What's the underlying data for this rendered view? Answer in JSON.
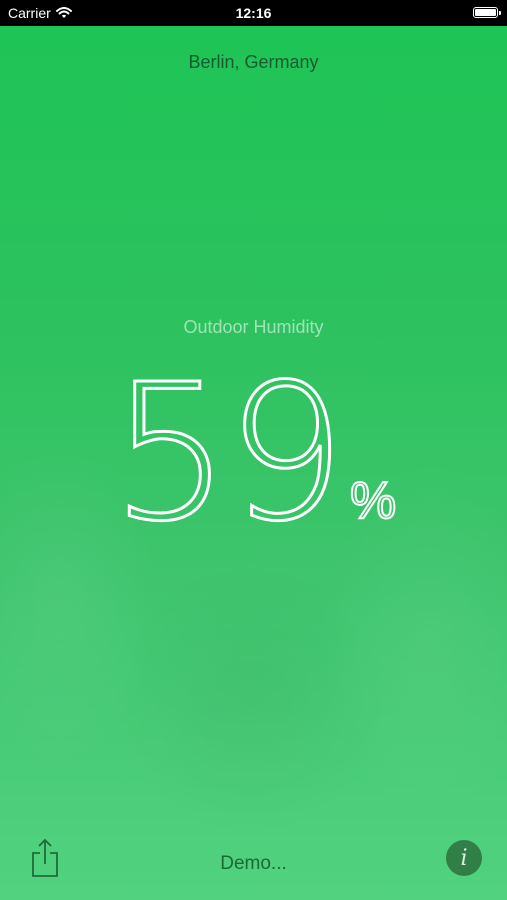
{
  "status_bar": {
    "carrier": "Carrier",
    "time": "12:16",
    "wifi_icon": "wifi-icon",
    "battery_icon": "battery-icon"
  },
  "location": "Berlin, Germany",
  "metric": {
    "label": "Outdoor Humidity",
    "value": "59",
    "unit": "%"
  },
  "footer": {
    "share_icon": "share-icon",
    "demo_label": "Demo...",
    "info_icon": "info-icon",
    "info_glyph": "i"
  },
  "colors": {
    "background_top": "#1dc455",
    "background_bottom": "#52d27f",
    "location_text": "#165c2c",
    "info_button": "#2f7f47"
  }
}
